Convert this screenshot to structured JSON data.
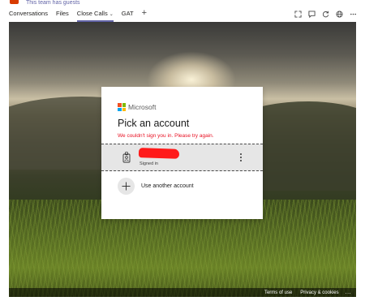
{
  "header": {
    "guests_note": "This team has guests",
    "team_avatar_color": "#d83b01"
  },
  "tabs": [
    {
      "label": "Conversations",
      "active": false
    },
    {
      "label": "Files",
      "active": false
    },
    {
      "label": "Close Calls",
      "active": true
    },
    {
      "label": "GAT",
      "active": false
    }
  ],
  "toolbar_icons": [
    "expand-icon",
    "chat-icon",
    "refresh-icon",
    "globe-icon",
    "more-icon"
  ],
  "login": {
    "brand": "Microsoft",
    "title": "Pick an account",
    "error": "We couldn't sign you in. Please try again.",
    "account_status": "Signed in",
    "other_account": "Use another account"
  },
  "footer": {
    "terms": "Terms of use",
    "privacy": "Privacy & cookies",
    "more": "..."
  },
  "colors": {
    "accent": "#6264a7",
    "error": "#e81123",
    "ms_red": "#f25022",
    "ms_green": "#7fba00",
    "ms_blue": "#00a4ef",
    "ms_yellow": "#ffb900"
  }
}
